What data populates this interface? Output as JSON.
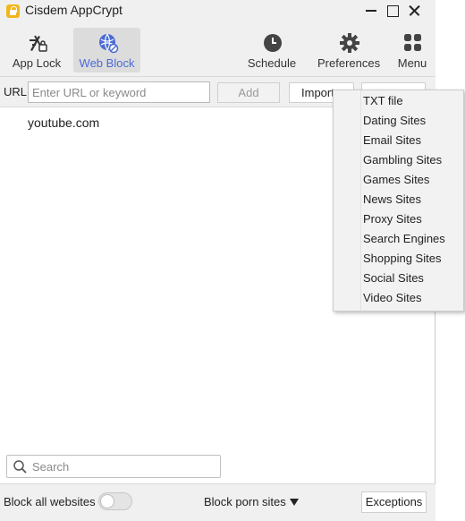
{
  "window": {
    "title": "Cisdem AppCrypt",
    "accent_color": "#4a6bd6"
  },
  "toolbar": {
    "tabs": [
      {
        "label": "App Lock",
        "icon": "app-lock-icon"
      },
      {
        "label": "Web Block",
        "icon": "globe-block-icon",
        "active": true
      },
      {
        "label": "Schedule",
        "icon": "clock-icon"
      },
      {
        "label": "Preferences",
        "icon": "gear-icon"
      },
      {
        "label": "Menu",
        "icon": "grid-icon"
      }
    ]
  },
  "urlbar": {
    "label": "URL",
    "placeholder": "Enter URL or keyword",
    "value": "",
    "add_label": "Add",
    "import_label": "Import"
  },
  "blocklist": {
    "items": [
      "youtube.com"
    ]
  },
  "search": {
    "placeholder": "Search"
  },
  "statusbar": {
    "block_all_label": "Block all websites",
    "block_all_enabled": false,
    "porn_label": "Block porn sites",
    "exceptions_label": "Exceptions"
  },
  "import_menu": {
    "items": [
      "TXT file",
      "Dating Sites",
      "Email Sites",
      "Gambling Sites",
      "Games Sites",
      "News Sites",
      "Proxy Sites",
      "Search Engines",
      "Shopping Sites",
      "Social Sites",
      "Video Sites"
    ]
  }
}
